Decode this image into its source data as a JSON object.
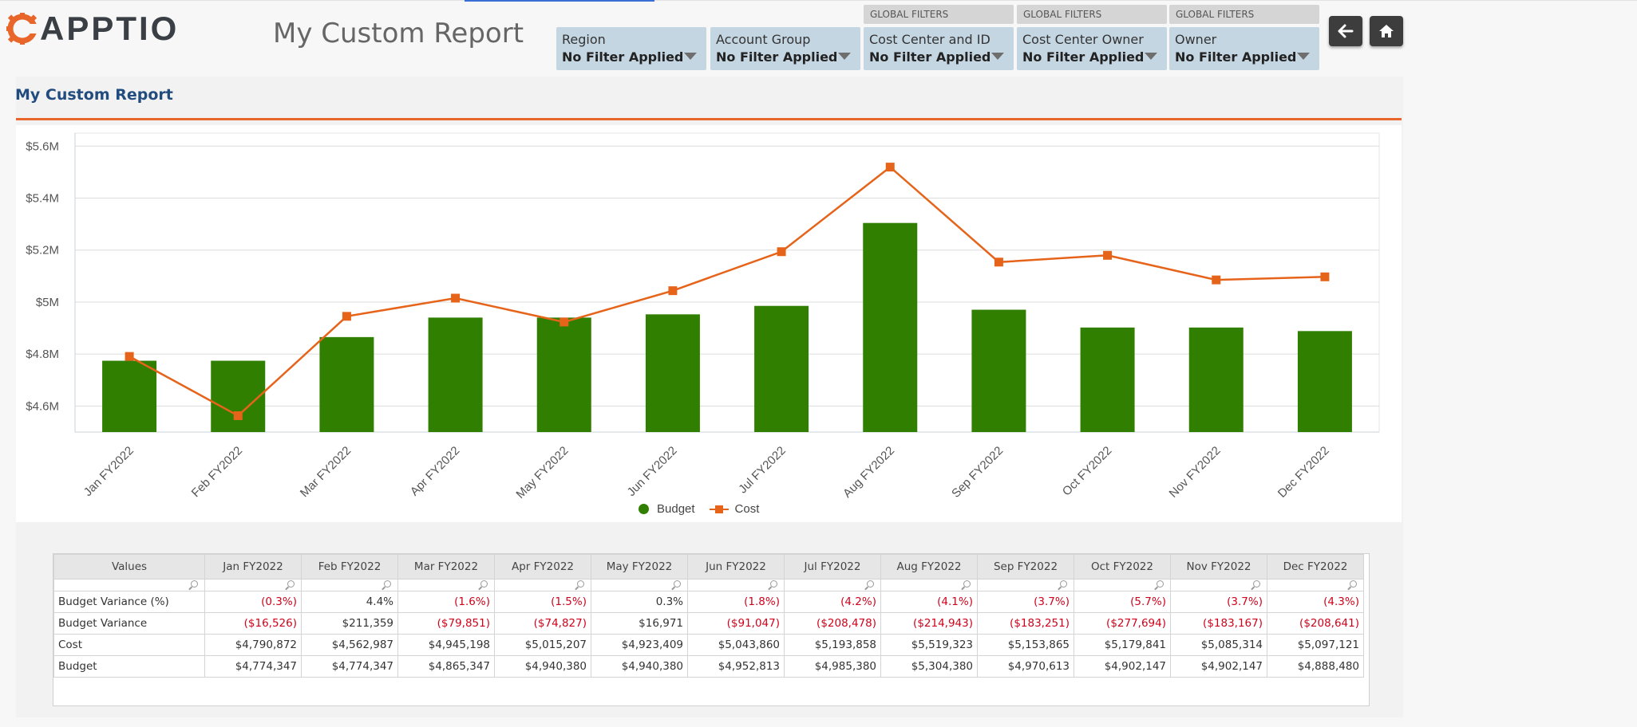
{
  "app": {
    "brand": "APPTIO",
    "page_title": "My Custom Report"
  },
  "filters": [
    {
      "label": "Region",
      "value": "No Filter Applied",
      "global": false,
      "global_tag": ""
    },
    {
      "label": "Account Group",
      "value": "No Filter Applied",
      "global": false,
      "global_tag": ""
    },
    {
      "label": "Cost Center and ID",
      "value": "No Filter Applied",
      "global": true,
      "global_tag": "GLOBAL FILTERS"
    },
    {
      "label": "Cost Center Owner",
      "value": "No Filter Applied",
      "global": true,
      "global_tag": "GLOBAL FILTERS"
    },
    {
      "label": "Owner",
      "value": "No Filter Applied",
      "global": true,
      "global_tag": "GLOBAL FILTERS"
    }
  ],
  "nav": {
    "back_icon": "arrow-left-icon",
    "home_icon": "home-icon"
  },
  "report": {
    "title": "My Custom Report"
  },
  "colors": {
    "budget": "#307f00",
    "cost": "#e6631a",
    "accent_rule": "#e8662a",
    "title": "#234c7e",
    "negative": "#d0021b"
  },
  "chart_data": {
    "type": "bar",
    "categories": [
      "Jan FY2022",
      "Feb FY2022",
      "Mar FY2022",
      "Apr FY2022",
      "May FY2022",
      "Jun FY2022",
      "Jul FY2022",
      "Aug FY2022",
      "Sep FY2022",
      "Oct FY2022",
      "Nov FY2022",
      "Dec FY2022"
    ],
    "series": [
      {
        "name": "Budget",
        "kind": "bar",
        "values": [
          4774347,
          4774347,
          4865347,
          4940380,
          4940380,
          4952813,
          4985380,
          5304380,
          4970613,
          4902147,
          4902147,
          4888480
        ]
      },
      {
        "name": "Cost",
        "kind": "line",
        "values": [
          4790872,
          4562987,
          4945198,
          5015207,
          4923409,
          5043860,
          5193858,
          5519323,
          5153865,
          5179841,
          5085314,
          5097121
        ]
      }
    ],
    "yticks": [
      "$4.6M",
      "$4.8M",
      "$5M",
      "$5.2M",
      "$5.4M",
      "$5.6M"
    ],
    "ytick_values": [
      4600000,
      4800000,
      5000000,
      5200000,
      5400000,
      5600000
    ],
    "ylim": [
      4500000,
      5650000
    ],
    "grid": true,
    "legend": "bottom-center",
    "title": "",
    "xlabel": "",
    "ylabel": ""
  },
  "table": {
    "columns": [
      "Values",
      "Jan FY2022",
      "Feb FY2022",
      "Mar FY2022",
      "Apr FY2022",
      "May FY2022",
      "Jun FY2022",
      "Jul FY2022",
      "Aug FY2022",
      "Sep FY2022",
      "Oct FY2022",
      "Nov FY2022",
      "Dec FY2022"
    ],
    "rows": [
      {
        "label": "Budget Variance (%)",
        "cells": [
          "(0.3%)",
          "4.4%",
          "(1.6%)",
          "(1.5%)",
          "0.3%",
          "(1.8%)",
          "(4.2%)",
          "(4.1%)",
          "(3.7%)",
          "(5.7%)",
          "(3.7%)",
          "(4.3%)"
        ]
      },
      {
        "label": "Budget Variance",
        "cells": [
          "($16,526)",
          "$211,359",
          "($79,851)",
          "($74,827)",
          "$16,971",
          "($91,047)",
          "($208,478)",
          "($214,943)",
          "($183,251)",
          "($277,694)",
          "($183,167)",
          "($208,641)"
        ]
      },
      {
        "label": "Cost",
        "cells": [
          "$4,790,872",
          "$4,562,987",
          "$4,945,198",
          "$5,015,207",
          "$4,923,409",
          "$5,043,860",
          "$5,193,858",
          "$5,519,323",
          "$5,153,865",
          "$5,179,841",
          "$5,085,314",
          "$5,097,121"
        ]
      },
      {
        "label": "Budget",
        "cells": [
          "$4,774,347",
          "$4,774,347",
          "$4,865,347",
          "$4,940,380",
          "$4,940,380",
          "$4,952,813",
          "$4,985,380",
          "$5,304,380",
          "$4,970,613",
          "$4,902,147",
          "$4,902,147",
          "$4,888,480"
        ]
      }
    ]
  }
}
